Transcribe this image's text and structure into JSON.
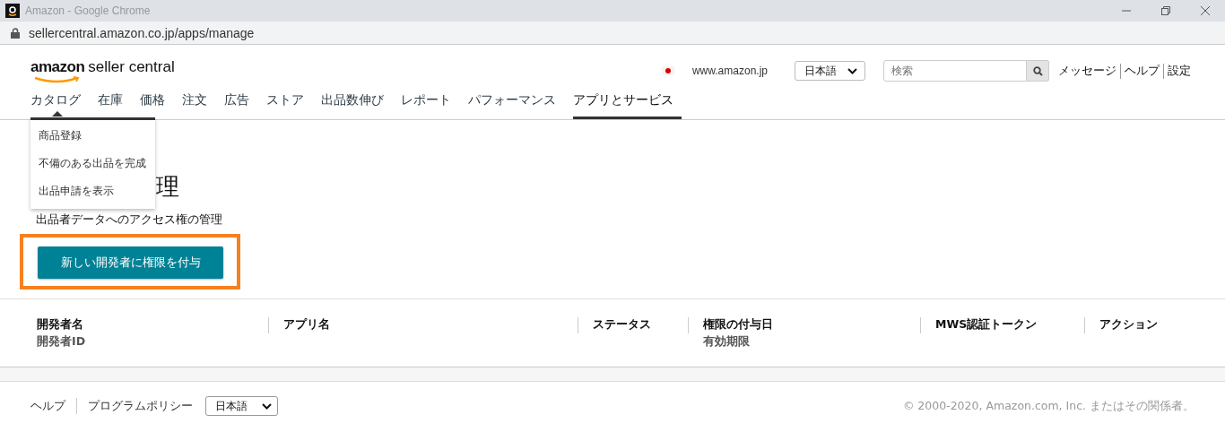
{
  "window": {
    "title": "Amazon - Google Chrome"
  },
  "address_bar": {
    "url": "sellercentral.amazon.co.jp/apps/manage"
  },
  "header": {
    "logo_brand": "amazon",
    "logo_product": "seller central",
    "marketplace": "www.amazon.jp",
    "language": "日本語",
    "search": {
      "placeholder": "検索"
    },
    "links": [
      "メッセージ",
      "ヘルプ",
      "設定"
    ]
  },
  "nav": [
    {
      "label": "カタログ",
      "selected": false,
      "expanded": true
    },
    {
      "label": "在庫",
      "selected": false,
      "expanded": false
    },
    {
      "label": "価格",
      "selected": false,
      "expanded": false
    },
    {
      "label": "注文",
      "selected": false,
      "expanded": false
    },
    {
      "label": "広告",
      "selected": false,
      "expanded": false
    },
    {
      "label": "ストア",
      "selected": false,
      "expanded": false
    },
    {
      "label": "出品数伸び",
      "selected": false,
      "expanded": false
    },
    {
      "label": "レポート",
      "selected": false,
      "expanded": false
    },
    {
      "label": "パフォーマンス",
      "selected": false,
      "expanded": false
    },
    {
      "label": "アプリとサービス",
      "selected": true,
      "expanded": false
    }
  ],
  "dropdown": [
    "商品登録",
    "不備のある出品を完成",
    "出品申請を表示"
  ],
  "page": {
    "title": "理",
    "subtitle": "出品者データへのアクセス権の管理",
    "button": {
      "label": "新しい開発者に権限を付与",
      "highlighted": true
    }
  },
  "table": {
    "columns": [
      {
        "label": "開発者名",
        "sublabel": "開発者ID"
      },
      {
        "label": "アプリ名"
      },
      {
        "label": "ステータス"
      },
      {
        "label": "権限の付与日",
        "sublabel": "有効期限"
      },
      {
        "label": "MWS認証トークン"
      },
      {
        "label": "アクション"
      }
    ]
  },
  "footer": {
    "links": [
      "ヘルプ",
      "プログラムポリシー"
    ],
    "language": "日本語",
    "copyright": "© 2000-2020, Amazon.com, Inc. またはその関係者。"
  }
}
